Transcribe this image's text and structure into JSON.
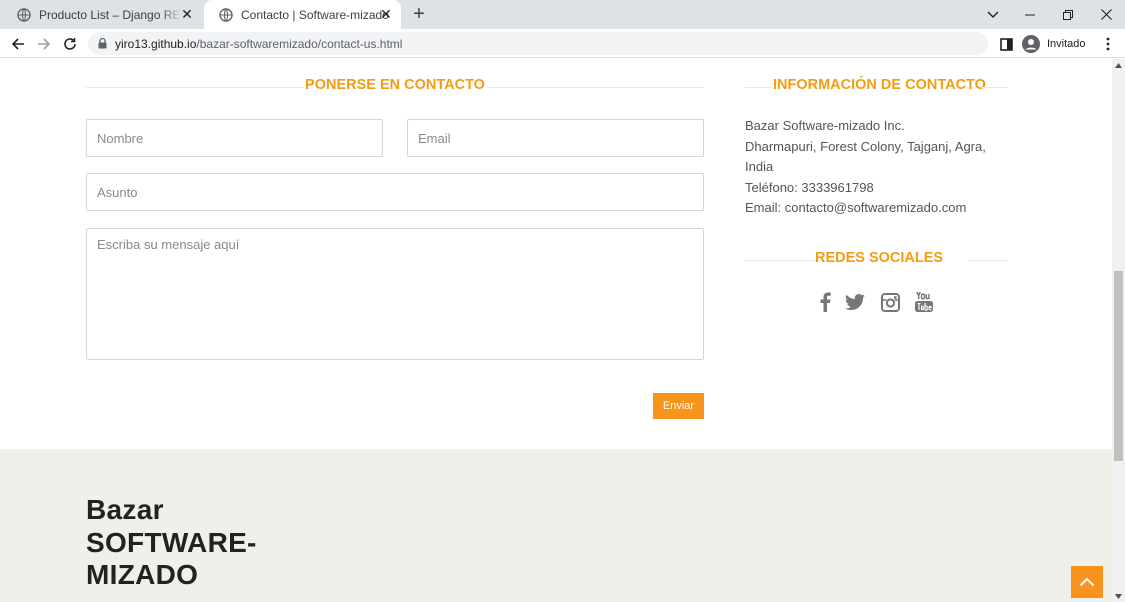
{
  "browser": {
    "tabs": [
      {
        "title": "Producto List – Django REST fram",
        "active": false
      },
      {
        "title": "Contacto | Software-mizado",
        "active": true
      }
    ],
    "url_host": "yiro13.github.io",
    "url_path": "/bazar-softwaremizado/contact-us.html",
    "profile_label": "Invitado"
  },
  "contact_form": {
    "heading": "PONERSE EN CONTACTO",
    "name_placeholder": "Nombre",
    "email_placeholder": "Email",
    "subject_placeholder": "Asunto",
    "message_placeholder": "Escriba su mensaje aquí",
    "submit_label": "Enviar"
  },
  "contact_info": {
    "heading": "INFORMACIÓN DE CONTACTO",
    "lines": [
      "Bazar Software-mizado Inc.",
      "Dharmapuri, Forest Colony, Tajganj, Agra,",
      "India",
      "Teléfono: 3333961798",
      "Email: contacto@softwaremizado.com"
    ]
  },
  "social": {
    "heading": "REDES SOCIALES",
    "networks": [
      "facebook-icon",
      "twitter-icon",
      "instagram-icon",
      "youtube-icon"
    ]
  },
  "footer": {
    "brand_lines": [
      "Bazar",
      "SOFTWARE-",
      "MIZADO"
    ]
  },
  "colors": {
    "accent": "#f7941d",
    "heading": "#f39c12",
    "footer_bg": "#f0efe9"
  }
}
